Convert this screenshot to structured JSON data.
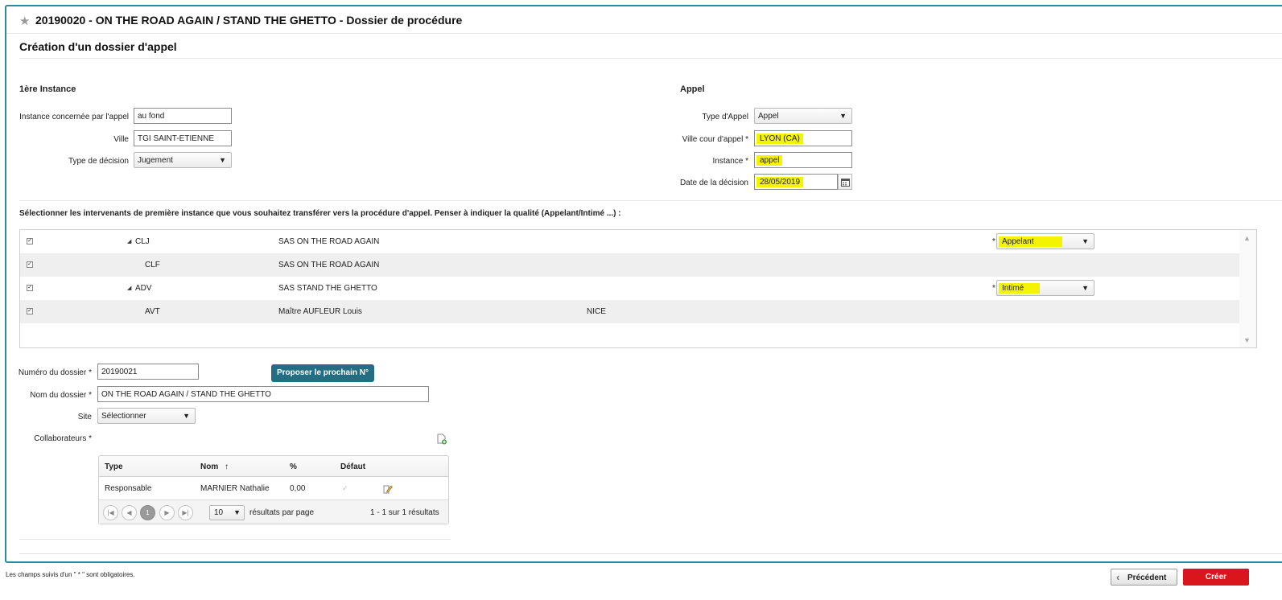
{
  "header": {
    "title": "20190020 - ON THE ROAD AGAIN / STAND THE GHETTO - Dossier de procédure",
    "subtitle": "Création d'un dossier d'appel"
  },
  "first_instance": {
    "heading": "1ère Instance",
    "instance_label": "Instance concernée par l'appel",
    "instance_value": "au fond",
    "ville_label": "Ville",
    "ville_value": "TGI SAINT-ETIENNE",
    "type_decision_label": "Type de décision",
    "type_decision_value": "Jugement"
  },
  "appeal": {
    "heading": "Appel",
    "type_label": "Type d'Appel",
    "type_value": "Appel",
    "ville_cour_label": "Ville cour d'appel *",
    "ville_cour_value": "LYON (CA)",
    "instance_label": "Instance *",
    "instance_value": "appel",
    "date_label": "Date de la décision",
    "date_value": "28/05/2019"
  },
  "intervenants": {
    "intro": "Sélectionner les intervenants de première instance que vous souhaitez transférer vers la procédure d'appel. Penser à indiquer la qualité (Appelant/Intimé ...) :",
    "rows": [
      {
        "code": "CLJ",
        "name": "SAS ON THE ROAD AGAIN",
        "city": "",
        "quality": "Appelant"
      },
      {
        "code": "CLF",
        "name": "SAS ON THE ROAD AGAIN",
        "city": "",
        "quality": ""
      },
      {
        "code": "ADV",
        "name": "SAS STAND THE GHETTO",
        "city": "",
        "quality": "Intimé"
      },
      {
        "code": "AVT",
        "name": "Maître AUFLEUR Louis",
        "city": "NICE",
        "quality": ""
      }
    ]
  },
  "dossier": {
    "numero_label": "Numéro du dossier *",
    "numero_value": "20190021",
    "propose_button": "Proposer le prochain N°",
    "nom_label": "Nom du dossier *",
    "nom_value": "ON THE ROAD AGAIN / STAND THE GHETTO",
    "site_label": "Site",
    "site_value": "Sélectionner",
    "collab_label": "Collaborateurs *"
  },
  "collaborateurs": {
    "col_type": "Type",
    "col_nom": "Nom",
    "col_pct": "%",
    "col_defaut": "Défaut",
    "row": {
      "type": "Responsable",
      "nom": "MARNIER Nathalie",
      "pct": "0,00"
    },
    "page_current": "1",
    "per_page": "10",
    "per_page_label": "résultats par page",
    "results_summary": "1 - 1 sur 1 résultats"
  },
  "footer": {
    "note": "Les champs suivis d'un \" * \" sont obligatoires.",
    "prev_button": "Précédent",
    "create_button": "Créer"
  },
  "colors": {
    "frame_border": "#2a8aa0",
    "propose_button": "#236e82",
    "create_button": "#d9161c",
    "highlight": "#f4f400"
  }
}
